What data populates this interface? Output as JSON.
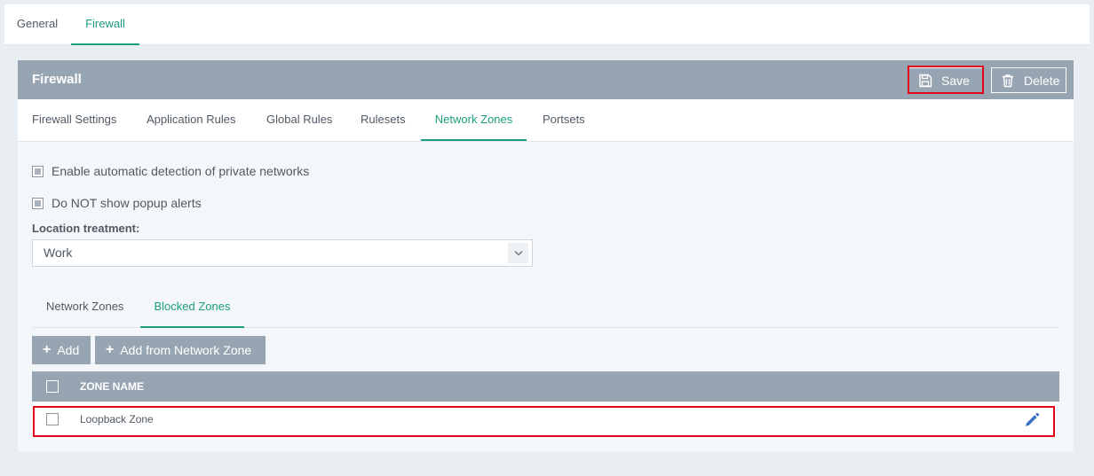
{
  "top_tabs": [
    {
      "label": "General",
      "active": false
    },
    {
      "label": "Firewall",
      "active": true
    }
  ],
  "panel": {
    "title": "Firewall",
    "save_label": "Save",
    "delete_label": "Delete"
  },
  "sub_tabs": [
    {
      "label": "Firewall Settings"
    },
    {
      "label": "Application Rules"
    },
    {
      "label": "Global Rules"
    },
    {
      "label": "Rulesets"
    },
    {
      "label": "Network Zones",
      "active": true
    },
    {
      "label": "Portsets"
    }
  ],
  "options": {
    "auto_detect_label": "Enable automatic detection of private networks",
    "no_popup_label": "Do NOT show popup alerts"
  },
  "location": {
    "label": "Location treatment:",
    "value": "Work"
  },
  "inner_tabs": [
    {
      "label": "Network Zones",
      "active": false
    },
    {
      "label": "Blocked Zones",
      "active": true
    }
  ],
  "actions": {
    "add_label": "Add",
    "add_from_zone_label": "Add from Network Zone"
  },
  "table": {
    "header": "ZONE NAME",
    "rows": [
      {
        "name": "Loopback Zone"
      }
    ]
  },
  "colors": {
    "accent": "#1a9e7d",
    "header_bg": "#97a5b3",
    "highlight": "#e0001a",
    "edit_icon": "#3b73c4"
  },
  "icons": {
    "save": "floppy-disk-icon",
    "delete": "trash-icon",
    "dropdown": "chevron-down-icon",
    "add": "plus-icon",
    "edit": "pencil-icon"
  }
}
